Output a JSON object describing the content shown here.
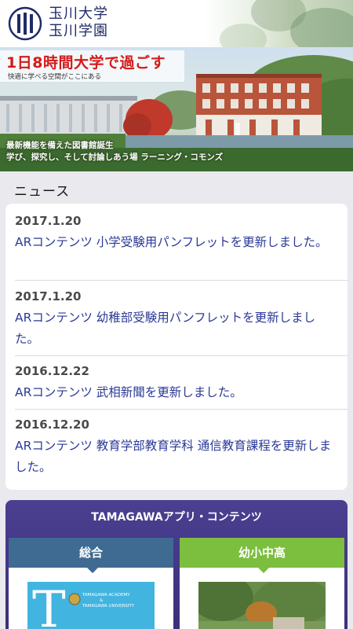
{
  "header": {
    "logo_line1": "玉川大学",
    "logo_line2": "玉川学園"
  },
  "banner": {
    "title": "1日8時間大学で過ごす",
    "subtitle": "快適に学べる空間がここにある",
    "caption_line1": "最新機能を備えた図書館誕生",
    "caption_line2": "学び、探究し、そして討論しあう場 ラーニング・コモンズ"
  },
  "news": {
    "heading": "ニュース",
    "items": [
      {
        "date": "2017.1.20",
        "text": "ARコンテンツ 小学受験用パンフレットを更新しました。"
      },
      {
        "date": "2017.1.20",
        "text": "ARコンテンツ 幼稚部受験用パンフレットを更新しました。"
      },
      {
        "date": "2016.12.22",
        "text": "ARコンテンツ 武相新聞を更新しました。"
      },
      {
        "date": "2016.12.20",
        "text": "ARコンテンツ 教育学部教育学科 通信教育課程を更新しました。"
      }
    ]
  },
  "apps": {
    "title": "TAMAGAWAアプリ・コンテンツ",
    "tabs": [
      {
        "label": "総合",
        "color": "#3f6a92"
      },
      {
        "label": "幼小中高",
        "color": "#7cbe3e"
      }
    ],
    "thumb_text_line1": "TAMAGAWA ACADEMY",
    "thumb_text_line2": "&",
    "thumb_text_line3": "TAMAGAWA UNIVERSITY"
  },
  "colors": {
    "brand_navy": "#1f2a66",
    "news_link": "#2b3a96",
    "banner_red": "#d51a1a",
    "apps_purple": "#4b3f91"
  }
}
